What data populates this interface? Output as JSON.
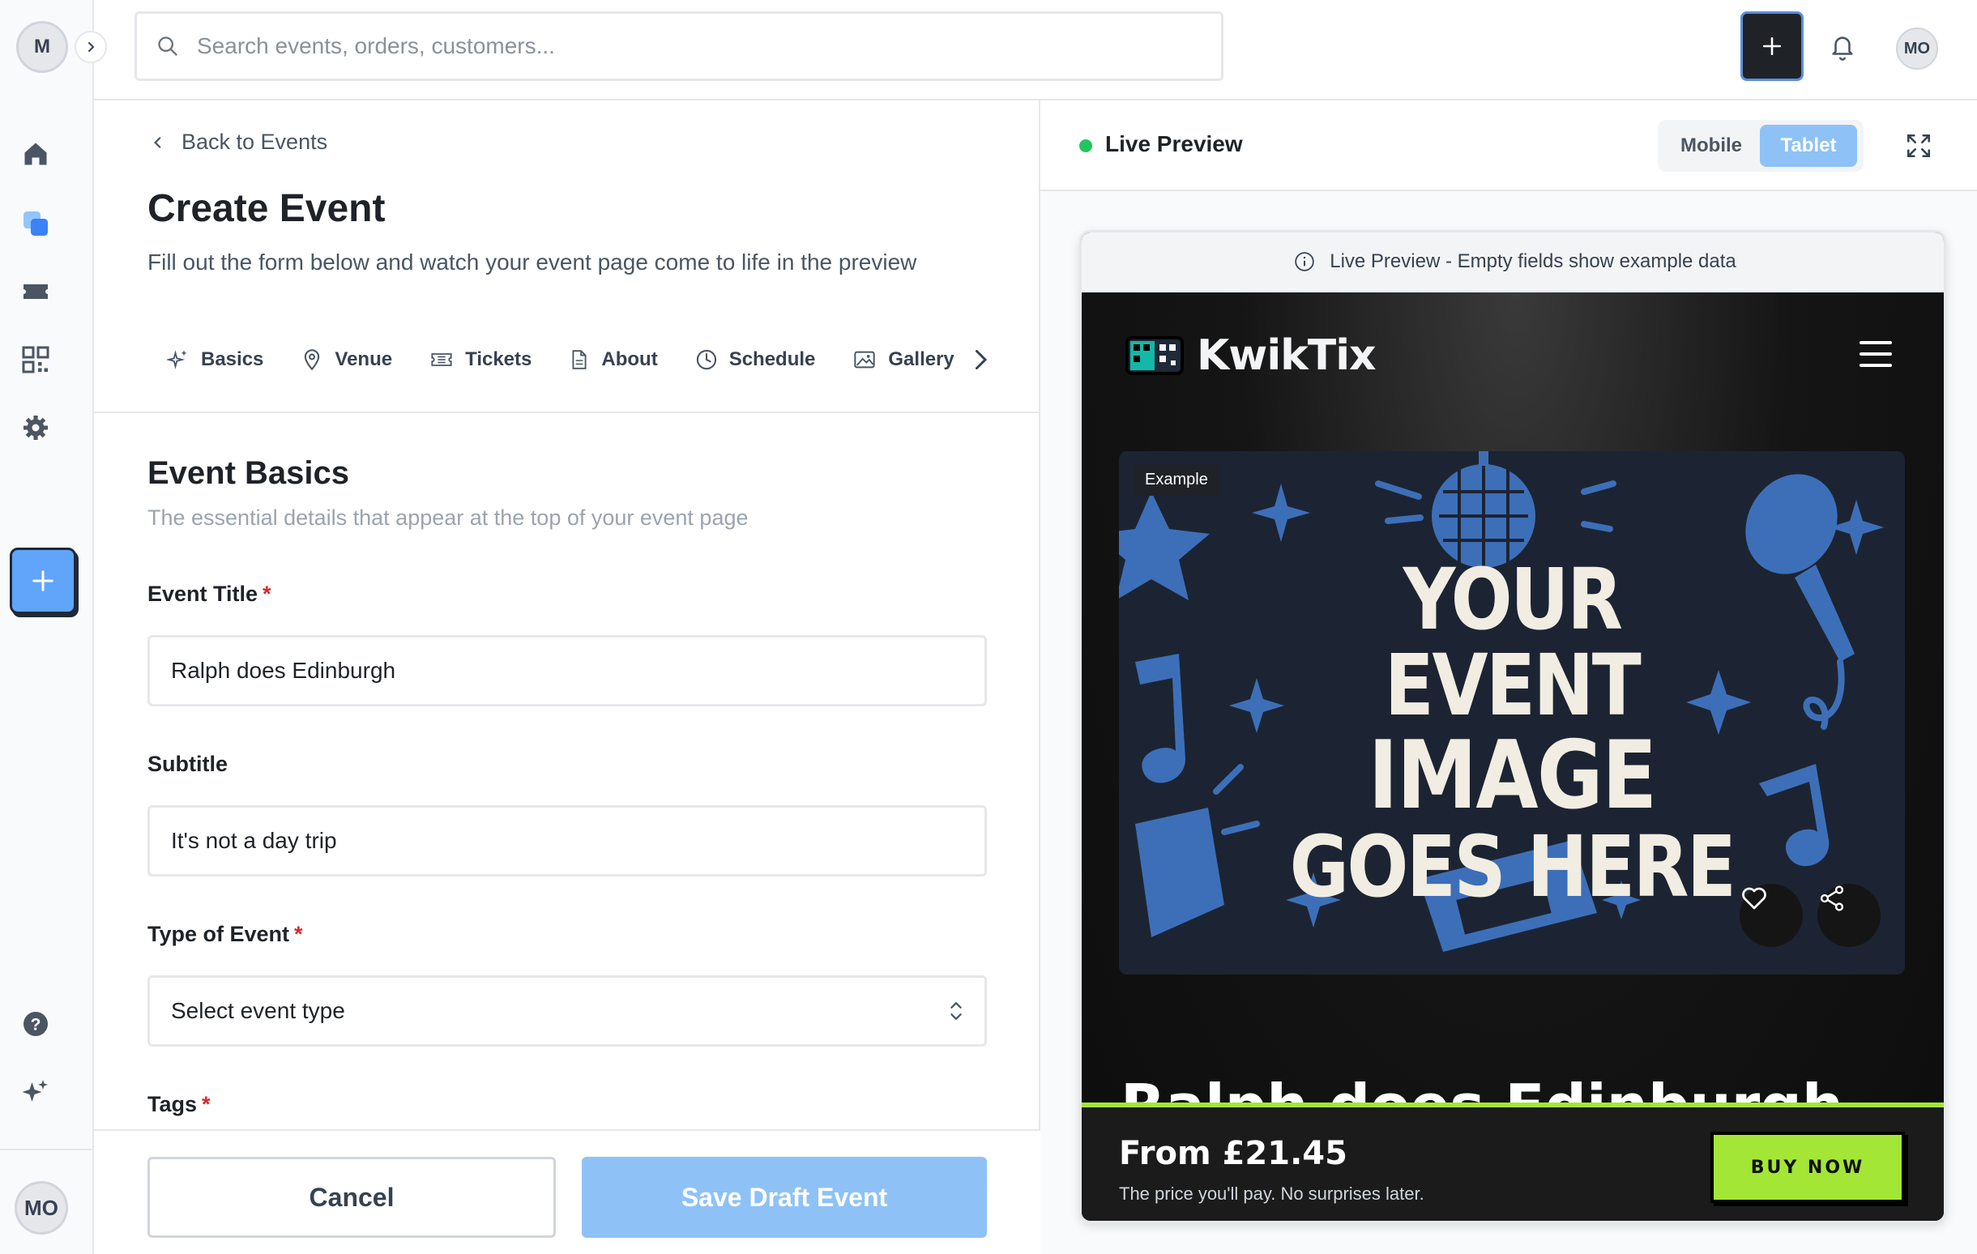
{
  "sidebar": {
    "workspace_initial": "M",
    "user_initials": "MO",
    "nav": [
      {
        "icon": "home-icon"
      },
      {
        "icon": "pages-icon"
      },
      {
        "icon": "ticket-icon"
      },
      {
        "icon": "qr-code-icon"
      },
      {
        "icon": "settings-icon"
      }
    ],
    "bottom": [
      {
        "icon": "help-icon"
      },
      {
        "icon": "sparkles-icon"
      }
    ]
  },
  "topbar": {
    "search_placeholder": "Search events, orders, customers...",
    "user_initials": "MO"
  },
  "form": {
    "back_label": "Back to Events",
    "title": "Create Event",
    "description": "Fill out the form below and watch your event page come to life in the preview",
    "tabs": [
      {
        "label": "Basics",
        "icon": "sparkles-icon"
      },
      {
        "label": "Venue",
        "icon": "map-pin-icon"
      },
      {
        "label": "Tickets",
        "icon": "ticket-icon"
      },
      {
        "label": "About",
        "icon": "document-icon"
      },
      {
        "label": "Schedule",
        "icon": "clock-icon"
      },
      {
        "label": "Gallery",
        "icon": "image-icon"
      }
    ],
    "section": {
      "title": "Event Basics",
      "description": "The essential details that appear at the top of your event page"
    },
    "fields": {
      "event_title": {
        "label": "Event Title",
        "required_mark": "*",
        "value": "Ralph does Edinburgh"
      },
      "subtitle": {
        "label": "Subtitle",
        "value": "It's not a day trip"
      },
      "event_type": {
        "label": "Type of Event",
        "required_mark": "*",
        "value": "Select event type"
      },
      "tags": {
        "label": "Tags",
        "required_mark": "*"
      }
    },
    "actions": {
      "cancel": "Cancel",
      "save": "Save Draft Event"
    }
  },
  "preview": {
    "title": "Live Preview",
    "devices": [
      "Mobile",
      "Tablet"
    ],
    "active_device": "Tablet",
    "notice": "Live Preview - Empty fields show example data",
    "site": {
      "brand": "KwikTix",
      "hero_badge": "Example",
      "hero_lines": [
        "YOUR EVENT",
        "IMAGE",
        "GOES HERE"
      ],
      "event_title": "Ralph does Edinburgh",
      "price": "From £21.45",
      "price_note": "The price you'll pay. No surprises later.",
      "buy_label": "BUY NOW"
    }
  },
  "colors": {
    "accent_blue": "#60a5fa",
    "save_button": "#8ec2f7",
    "live_green": "#22c55e",
    "buy_green": "#a3e635",
    "required_red": "#dc2626"
  }
}
